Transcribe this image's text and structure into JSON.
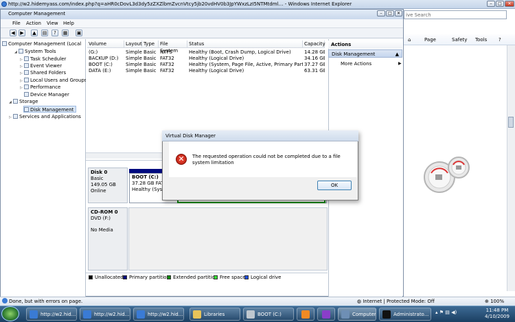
{
  "browser": {
    "title": "http://w2.hidemyass.com/index.php?q=aHR0cDovL3d3dy5zZXZlbmZvcnVtcy5jb20vdHV0b3JpYWxzLzI5NTMtdml… - Windows Internet Explorer",
    "search_placeholder": "ive Search",
    "command_bar": {
      "page": "Page",
      "safety": "Safety",
      "tools": "Tools"
    },
    "status_text": "Done, but with errors on page.",
    "zone": "Internet | Protected Mode: Off",
    "zoom": "100%"
  },
  "mmc": {
    "title": "Computer Management",
    "menu": [
      "File",
      "Action",
      "View",
      "Help"
    ],
    "tree": {
      "root": "Computer Management (Local",
      "system_tools": "System Tools",
      "task_scheduler": "Task Scheduler",
      "event_viewer": "Event Viewer",
      "shared_folders": "Shared Folders",
      "local_users": "Local Users and Groups",
      "performance": "Performance",
      "device_manager": "Device Manager",
      "storage": "Storage",
      "disk_management": "Disk Management",
      "services": "Services and Applications"
    },
    "volume_columns": [
      "Volume",
      "Layout",
      "Type",
      "File System",
      "Status",
      "Capacity"
    ],
    "volumes": [
      {
        "volume": "(G:)",
        "layout": "Simple",
        "type": "Basic",
        "fs": "NTFS",
        "status": "Healthy (Boot, Crash Dump, Logical Drive)",
        "capacity": "14.28 GB"
      },
      {
        "volume": "BACKUP (D:)",
        "layout": "Simple",
        "type": "Basic",
        "fs": "FAT32",
        "status": "Healthy (Logical Drive)",
        "capacity": "34.16 GB"
      },
      {
        "volume": "BOOT (C:)",
        "layout": "Simple",
        "type": "Basic",
        "fs": "FAT32",
        "status": "Healthy (System, Page File, Active, Primary Partition)",
        "capacity": "37.27 GB"
      },
      {
        "volume": "DATA (E:)",
        "layout": "Simple",
        "type": "Basic",
        "fs": "FAT32",
        "status": "Healthy (Logical Drive)",
        "capacity": "63.31 GB"
      }
    ],
    "disk0": {
      "name": "Disk 0",
      "type": "Basic",
      "size": "149.05 GB",
      "state": "Online",
      "partition_name": "BOOT  (C:)",
      "partition_detail": "37.28 GB FAT3",
      "partition_status": "Healthy (Syste"
    },
    "cdrom0": {
      "name": "CD-ROM 0",
      "drive": "DVD (F:)",
      "media": "No Media"
    },
    "legend": [
      {
        "label": "Unallocated",
        "color": "#000000"
      },
      {
        "label": "Primary partition",
        "color": "#000a7f"
      },
      {
        "label": "Extended partition",
        "color": "#0a8a0a"
      },
      {
        "label": "Free space",
        "color": "#36e036"
      },
      {
        "label": "Logical drive",
        "color": "#1f4fe0"
      }
    ],
    "actions": {
      "header": "Actions",
      "section": "Disk Management",
      "more": "More Actions"
    }
  },
  "dialog": {
    "title": "Virtual Disk Manager",
    "message": "The requested operation could not be completed due to a file system limitation",
    "ok": "OK",
    "icon": "error-icon"
  },
  "taskbar": {
    "items": [
      "http://w2.hid...",
      "http://w2.hid...",
      "http://w2.hid...",
      "Libraries",
      "BOOT (C:)",
      "",
      "",
      "Computer M...",
      "Administrato..."
    ],
    "time": "11:48 PM",
    "date": "4/10/2009"
  }
}
